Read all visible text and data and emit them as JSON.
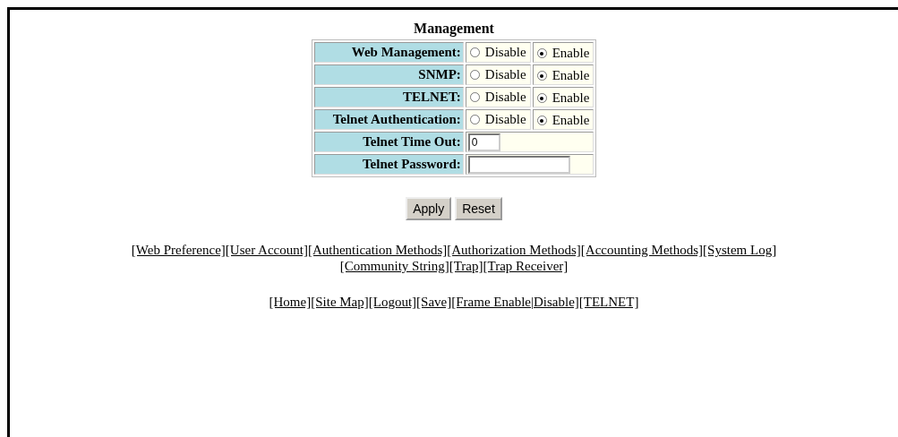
{
  "title": "Management",
  "rows": [
    {
      "kind": "radio",
      "label": "Web Management:",
      "options": [
        {
          "label": "Disable",
          "selected": false
        },
        {
          "label": "Enable",
          "selected": true
        }
      ]
    },
    {
      "kind": "radio",
      "label": "SNMP:",
      "options": [
        {
          "label": "Disable",
          "selected": false
        },
        {
          "label": "Enable",
          "selected": true
        }
      ]
    },
    {
      "kind": "radio",
      "label": "TELNET:",
      "options": [
        {
          "label": "Disable",
          "selected": false
        },
        {
          "label": "Enable",
          "selected": true
        }
      ]
    },
    {
      "kind": "radio",
      "label": "Telnet Authentication:",
      "options": [
        {
          "label": "Disable",
          "selected": false
        },
        {
          "label": "Enable",
          "selected": true
        }
      ]
    },
    {
      "kind": "text",
      "label": "Telnet Time Out:",
      "value": "0"
    },
    {
      "kind": "password",
      "label": "Telnet Password:"
    }
  ],
  "buttons": [
    "Apply",
    "Reset"
  ],
  "link_lines": [
    [
      "[Web Preference]",
      "[User Account]",
      "[Authentication Methods]",
      "[Authorization Methods]",
      "[Accounting Methods]",
      "[System Log]"
    ],
    [
      "[Community String]",
      "[Trap]",
      "[Trap Receiver]"
    ]
  ],
  "nav_links": [
    "[Home]",
    "[Site Map]",
    "[Logout]",
    "[Save]",
    "[Frame Enable|Disable]",
    "[TELNET]"
  ]
}
